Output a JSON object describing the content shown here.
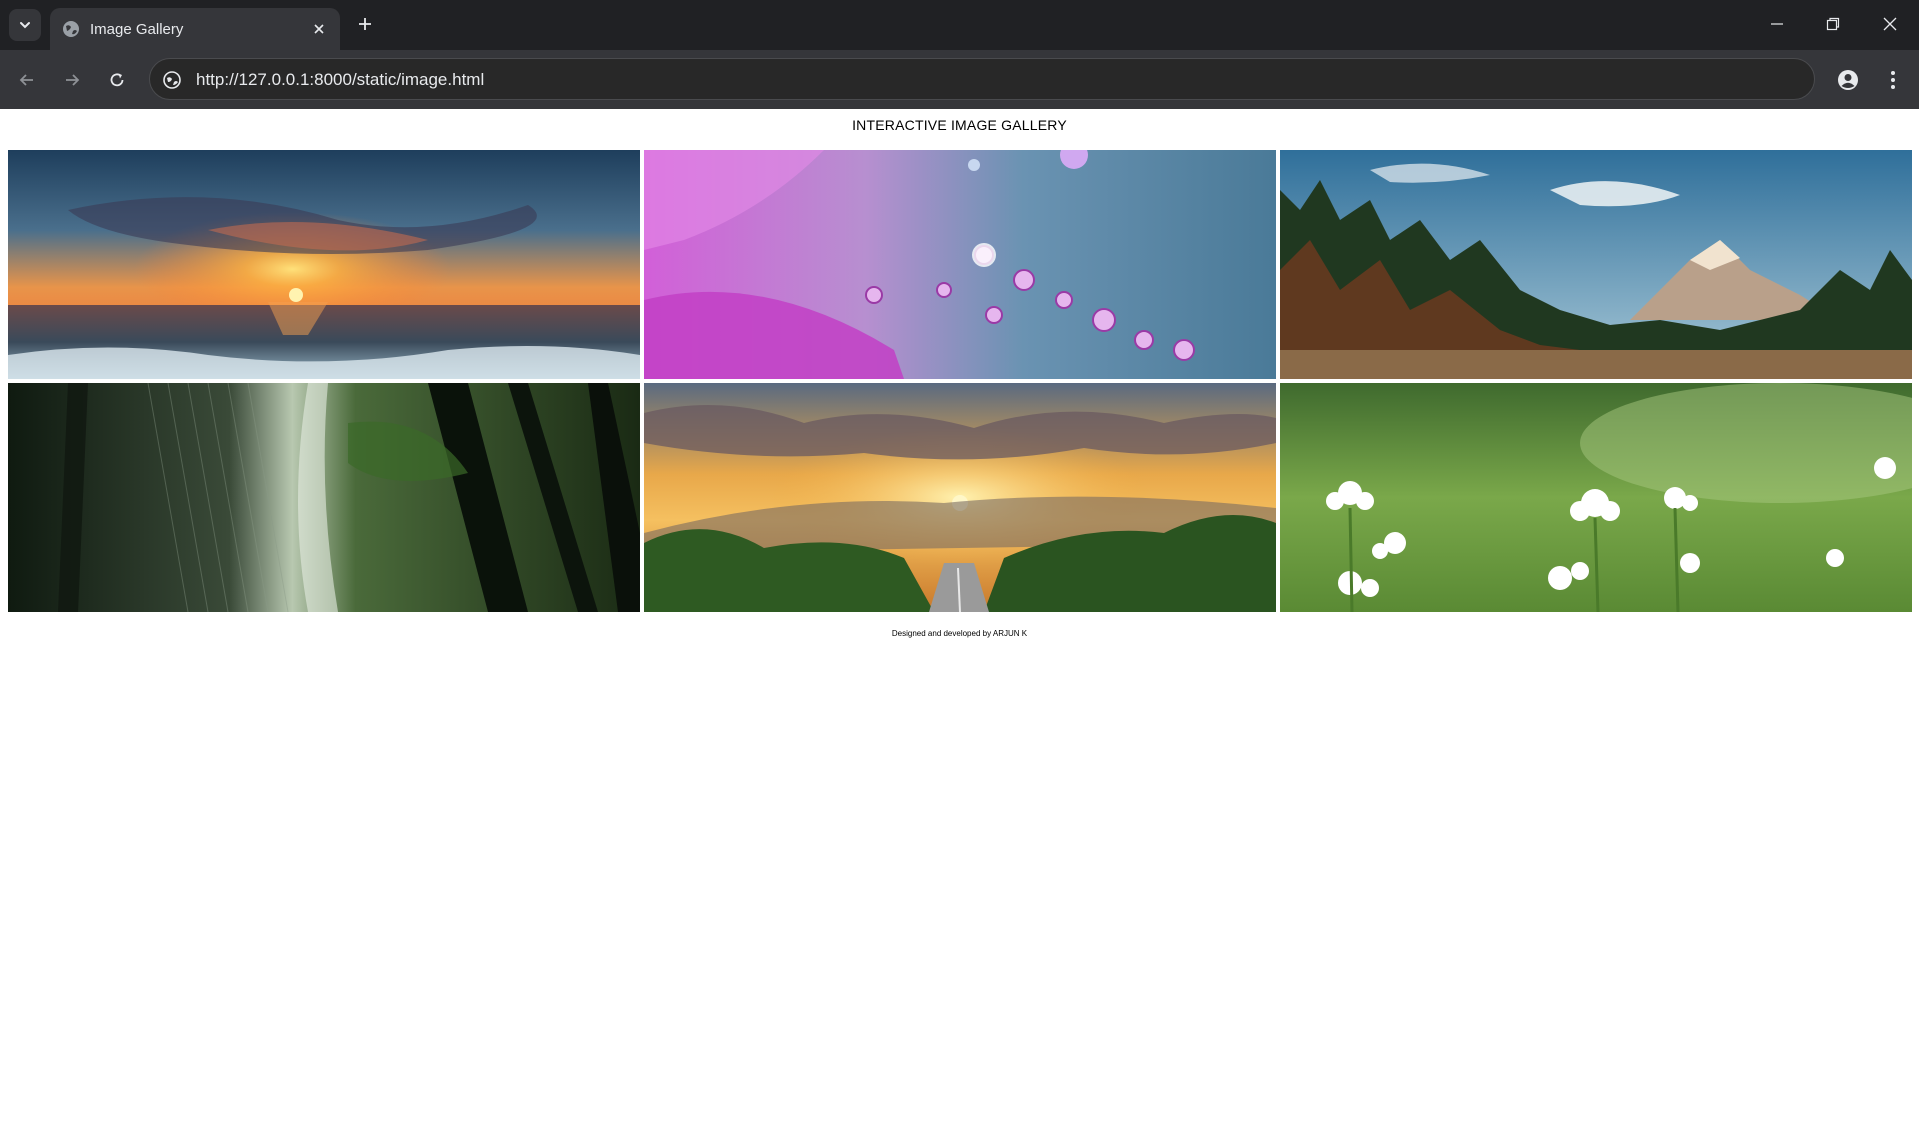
{
  "browser": {
    "tab": {
      "title": "Image Gallery",
      "favicon": "globe-icon"
    },
    "address_bar": {
      "url": "http://127.0.0.1:8000/static/image.html",
      "site_info_icon": "site-info-icon"
    },
    "colors": {
      "titlebar": "#202124",
      "toolbar": "#35363a",
      "text": "#e8eaed"
    }
  },
  "page": {
    "title": "INTERACTIVE IMAGE GALLERY",
    "images": [
      {
        "subject": "ocean-sunset-image"
      },
      {
        "subject": "purple-droplets-image"
      },
      {
        "subject": "mountain-forest-image"
      },
      {
        "subject": "rainy-forest-image"
      },
      {
        "subject": "sunset-road-image"
      },
      {
        "subject": "white-flowers-image"
      }
    ],
    "footer": "Designed and developed by ARJUN K"
  }
}
